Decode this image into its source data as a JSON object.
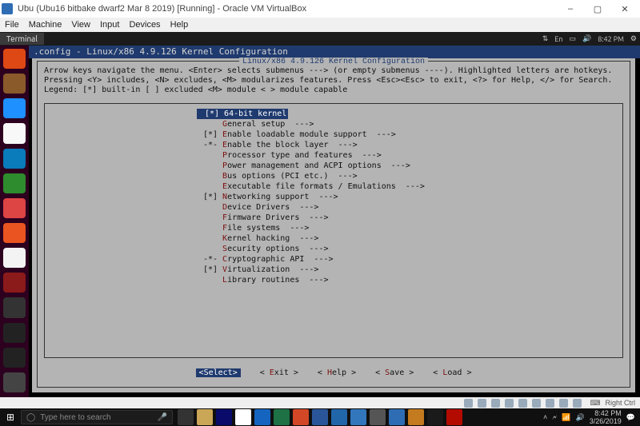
{
  "host": {
    "title": "Ubu (Ubu16 bitbake dwarf2 Mar 8 2019) [Running] - Oracle VM VirtualBox",
    "window_buttons": {
      "min": "–",
      "max": "▢",
      "close": "✕"
    },
    "menu": [
      "File",
      "Machine",
      "View",
      "Input",
      "Devices",
      "Help"
    ],
    "status_label": "Right Ctrl"
  },
  "gnome": {
    "active_app": "Terminal",
    "indicators": {
      "lang": "En",
      "vol": "🔊",
      "net": "⏻",
      "time": "8:42 PM",
      "gear": "⚙"
    }
  },
  "launcher": {
    "items": [
      {
        "name": "dash-icon",
        "bg": "#dd4814"
      },
      {
        "name": "files-icon",
        "bg": "#8b5a2b"
      },
      {
        "name": "firefox-icon",
        "bg": "#1e90ff"
      },
      {
        "name": "libreoffice-icon",
        "bg": "#f8f8f8"
      },
      {
        "name": "writer-icon",
        "bg": "#0a7bbb"
      },
      {
        "name": "calc-icon",
        "bg": "#2e8b2e"
      },
      {
        "name": "impress-icon",
        "bg": "#d44"
      },
      {
        "name": "ubuntu-software-icon",
        "bg": "#e95420"
      },
      {
        "name": "amazon-icon",
        "bg": "#f3f3f3"
      },
      {
        "name": "settings-icon",
        "bg": "#8b1a1a"
      },
      {
        "name": "unknown-icon",
        "bg": "#333"
      },
      {
        "name": "updater-icon",
        "bg": "#222"
      },
      {
        "name": "terminal-icon",
        "bg": "#222"
      },
      {
        "name": "trash-icon",
        "bg": "#444"
      }
    ]
  },
  "terminal": {
    "title": " .config - Linux/x86 4.9.126 Kernel Configuration",
    "kconfig_title": "Linux/x86 4.9.126 Kernel Configuration",
    "help": "Arrow keys navigate the menu.  <Enter> selects submenus ---> (or empty submenus ----).  Highlighted letters are hotkeys.  Pressing <Y> includes, <N>\nexcludes, <M> modularizes features.  Press <Esc><Esc> to exit, <?> for Help, </> for Search.  Legend: [*] built-in  [ ] excluded  <M> module  < > module\ncapable",
    "menu": [
      {
        "ind": "[*]",
        "hot": "6",
        "label": "4-bit kernel",
        "selected": true
      },
      {
        "ind": "",
        "hot": "G",
        "label": "eneral setup  --->"
      },
      {
        "ind": "[*]",
        "hot": "E",
        "label": "nable loadable module support  --->"
      },
      {
        "ind": "-*-",
        "hot": "E",
        "label": "nable the block layer  --->"
      },
      {
        "ind": "",
        "hot": "P",
        "label": "rocessor type and features  --->"
      },
      {
        "ind": "",
        "hot": "P",
        "label": "ower management and ACPI options  --->"
      },
      {
        "ind": "",
        "hot": "B",
        "label": "us options (PCI etc.)  --->"
      },
      {
        "ind": "",
        "hot": "E",
        "label": "xecutable file formats / Emulations  --->"
      },
      {
        "ind": "[*]",
        "hot": "N",
        "label": "etworking support  --->"
      },
      {
        "ind": "",
        "hot": "D",
        "label": "evice Drivers  --->"
      },
      {
        "ind": "",
        "hot": "F",
        "label": "irmware Drivers  --->"
      },
      {
        "ind": "",
        "hot": "F",
        "label": "ile systems  --->"
      },
      {
        "ind": "",
        "hot": "K",
        "label": "ernel hacking  --->"
      },
      {
        "ind": "",
        "hot": "S",
        "label": "ecurity options  --->"
      },
      {
        "ind": "-*-",
        "hot": "C",
        "label": "ryptographic API  --->"
      },
      {
        "ind": "[*]",
        "hot": "V",
        "label": "irtualization  --->"
      },
      {
        "ind": "",
        "hot": "L",
        "label": "ibrary routines  --->"
      }
    ],
    "buttons": [
      {
        "hot": "S",
        "label": "elect",
        "selected": true
      },
      {
        "hot": "E",
        "label": "xit"
      },
      {
        "hot": "H",
        "label": "elp"
      },
      {
        "hot": "S",
        "label": "ave"
      },
      {
        "hot": "L",
        "label": "oad"
      }
    ]
  },
  "taskbar": {
    "search_placeholder": "Type here to search",
    "clock_time": "8:42 PM",
    "clock_date": "3/26/2019",
    "apps": [
      {
        "name": "task-view-icon",
        "bg": "#333"
      },
      {
        "name": "explorer-icon",
        "bg": "#caa657"
      },
      {
        "name": "store-icon",
        "bg": "#0a0a6a"
      },
      {
        "name": "chrome-icon",
        "bg": "#fff"
      },
      {
        "name": "outlook-icon",
        "bg": "#1565c0"
      },
      {
        "name": "excel-icon",
        "bg": "#1e7145"
      },
      {
        "name": "powerpoint-icon",
        "bg": "#d24726"
      },
      {
        "name": "word-icon",
        "bg": "#2a5699"
      },
      {
        "name": "kdetool-icon",
        "bg": "#2266aa"
      },
      {
        "name": "edge-icon",
        "bg": "#3277bc"
      },
      {
        "name": "notepad-icon",
        "bg": "#555"
      },
      {
        "name": "virtualbox-icon",
        "bg": "#2e6db4"
      },
      {
        "name": "running-vm-icon",
        "bg": "#c47a1f"
      },
      {
        "name": "photos-icon",
        "bg": "#1a1a1a"
      },
      {
        "name": "adobe-icon",
        "bg": "#b30b00"
      }
    ]
  }
}
